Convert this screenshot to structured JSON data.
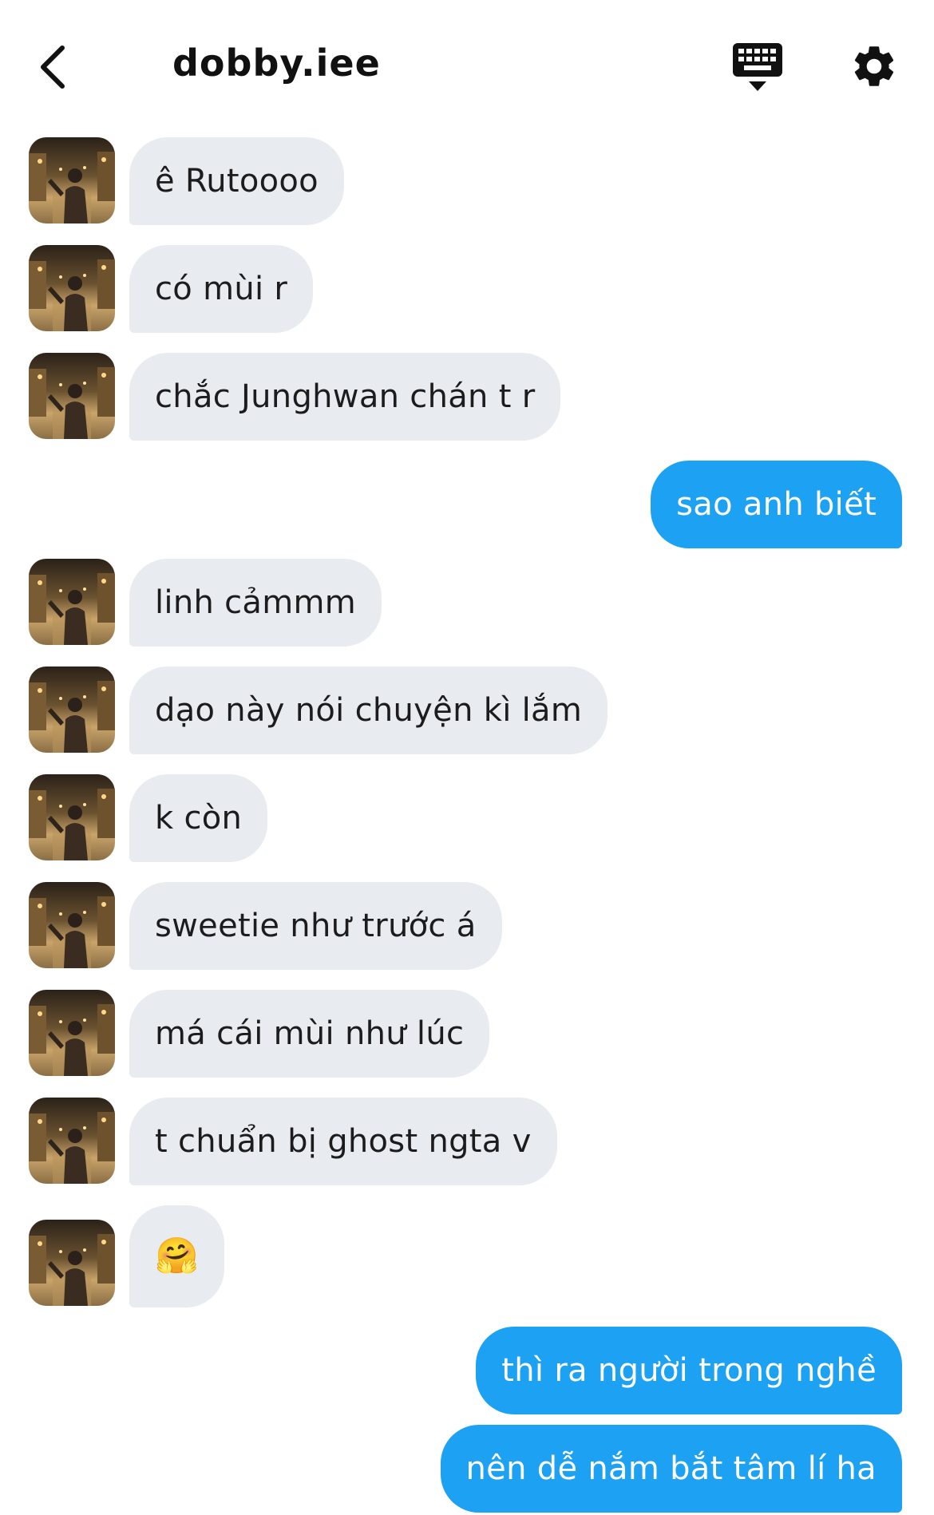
{
  "header": {
    "title": "dobby.iee"
  },
  "colors": {
    "outgoing_bubble": "#1da1f2",
    "incoming_bubble": "#e8ecf0"
  },
  "messages": [
    {
      "side": "in",
      "text": "ê Rutoooo"
    },
    {
      "side": "in",
      "text": "có mùi r"
    },
    {
      "side": "in",
      "text": "chắc Junghwan chán t r"
    },
    {
      "side": "out",
      "text": "sao anh biết"
    },
    {
      "side": "in",
      "text": "linh cảmmm"
    },
    {
      "side": "in",
      "text": "dạo này nói chuyện kì lắm"
    },
    {
      "side": "in",
      "text": "k còn"
    },
    {
      "side": "in",
      "text": "sweetie như trước á"
    },
    {
      "side": "in",
      "text": "má cái mùi như lúc"
    },
    {
      "side": "in",
      "text": "t chuẩn bị ghost ngta v"
    },
    {
      "side": "in",
      "text": "🤗"
    },
    {
      "side": "out",
      "text": "thì ra người trong nghề"
    },
    {
      "side": "out",
      "text": "nên dễ nắm bắt tâm lí ha"
    }
  ]
}
